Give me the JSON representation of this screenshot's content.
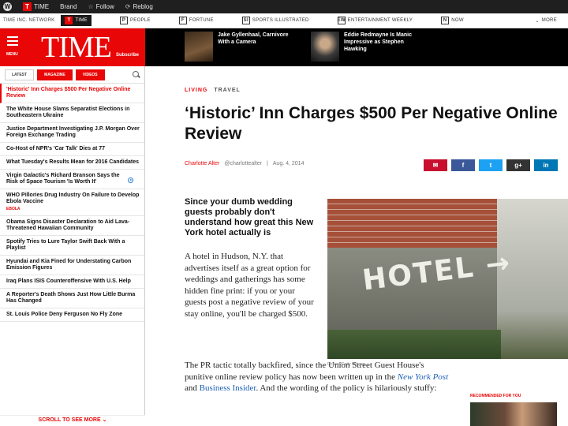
{
  "wp_bar": {
    "logo": "W",
    "site_label": "TIME",
    "brand_label": "Brand",
    "follow_label": "Follow",
    "reblog_label": "Reblog"
  },
  "network_bar": {
    "label": "TIME INC. NETWORK",
    "items": [
      {
        "icon": "T",
        "label": "TIME"
      },
      {
        "icon": "P",
        "label": "PEOPLE"
      },
      {
        "icon": "F",
        "label": "FORTUNE"
      },
      {
        "icon": "SI",
        "label": "SPORTS ILLUSTRATED"
      },
      {
        "icon": "EW",
        "label": "ENTERTAINMENT WEEKLY"
      },
      {
        "icon": "N",
        "label": "NOW"
      }
    ],
    "more_label": "MORE"
  },
  "header": {
    "menu_label": "MENU",
    "logo": "TIME",
    "subscribe": "Subscribe"
  },
  "promos": [
    {
      "text": "Jake Gyllenhaal, Carnivore With a Camera"
    },
    {
      "text": "Eddie Redmayne Is Manic Impressive as Stephen Hawking"
    }
  ],
  "sidebar": {
    "tabs": [
      "LATEST",
      "MAGAZINE",
      "VIDEOS"
    ],
    "items": [
      {
        "text": "'Historic' Inn Charges $500 Per Negative Online Review"
      },
      {
        "text": "The White House Slams Separatist Elections in Southeastern Ukraine"
      },
      {
        "text": "Justice Department Investigating J.P. Morgan Over Foreign Exchange Trading"
      },
      {
        "text": "Co-Host of NPR's 'Car Talk' Dies at 77"
      },
      {
        "text": "What Tuesday's Results Mean for 2016 Candidates"
      },
      {
        "text": "Virgin Galactic's Richard Branson Says the Risk of Space Tourism 'Is Worth It'"
      },
      {
        "text": "WHO Pillories Drug Industry On Failure to Develop Ebola Vaccine",
        "tag": "EBOLA"
      },
      {
        "text": "Obama Signs Disaster Declaration to Aid Lava-Threatened Hawaiian Community"
      },
      {
        "text": "Spotify Tries to Lure Taylor Swift Back With a Playlist"
      },
      {
        "text": "Hyundai and Kia Fined for Understating Carbon Emission Figures"
      },
      {
        "text": "Iraq Plans ISIS Counteroffensive With U.S. Help"
      },
      {
        "text": "A Reporter's Death Shows Just How Little Burma Has Changed"
      },
      {
        "text": "St. Louis Police Deny Ferguson No Fly Zone"
      }
    ],
    "scroll_more": "SCROLL TO SEE MORE"
  },
  "article": {
    "kicker": [
      "LIVING",
      "TRAVEL"
    ],
    "headline": "‘Historic’ Inn Charges $500 Per Negative Online Review",
    "author": "Charlotte Alter",
    "handle": "@charlottealter",
    "date": "Aug. 4, 2014",
    "share": [
      "f",
      "t",
      "g+",
      "in"
    ],
    "dek": "Since your dumb wedding guests probably don't understand how great this New York hotel actually is",
    "body1": "A hotel in Hudson, N.Y. that advertises itself as a great option for weddings and gatherings has some hidden fine print: if you or your guests post a negative review of your stay online, you'll be charged $500.",
    "body2_a": "The PR tactic totally backfired, since the Union Street Guest House's punitive online review policy has now been written up in the ",
    "body2_link1": "New York Post",
    "body2_mid": " and ",
    "body2_link2": "Business Insider",
    "body2_b": ". And the wording of the policy is hilariously stuffy:",
    "photo_sign": "HOTEL →",
    "credit": "Picavet/Getty Images",
    "recommended": "RECOMMENDED FOR YOU"
  },
  "colors": {
    "accent": "#e90606",
    "email": "#c8102e",
    "facebook": "#3b5998",
    "twitter": "#1da1f2",
    "gplus": "#333333",
    "linkedin": "#0077b5"
  }
}
